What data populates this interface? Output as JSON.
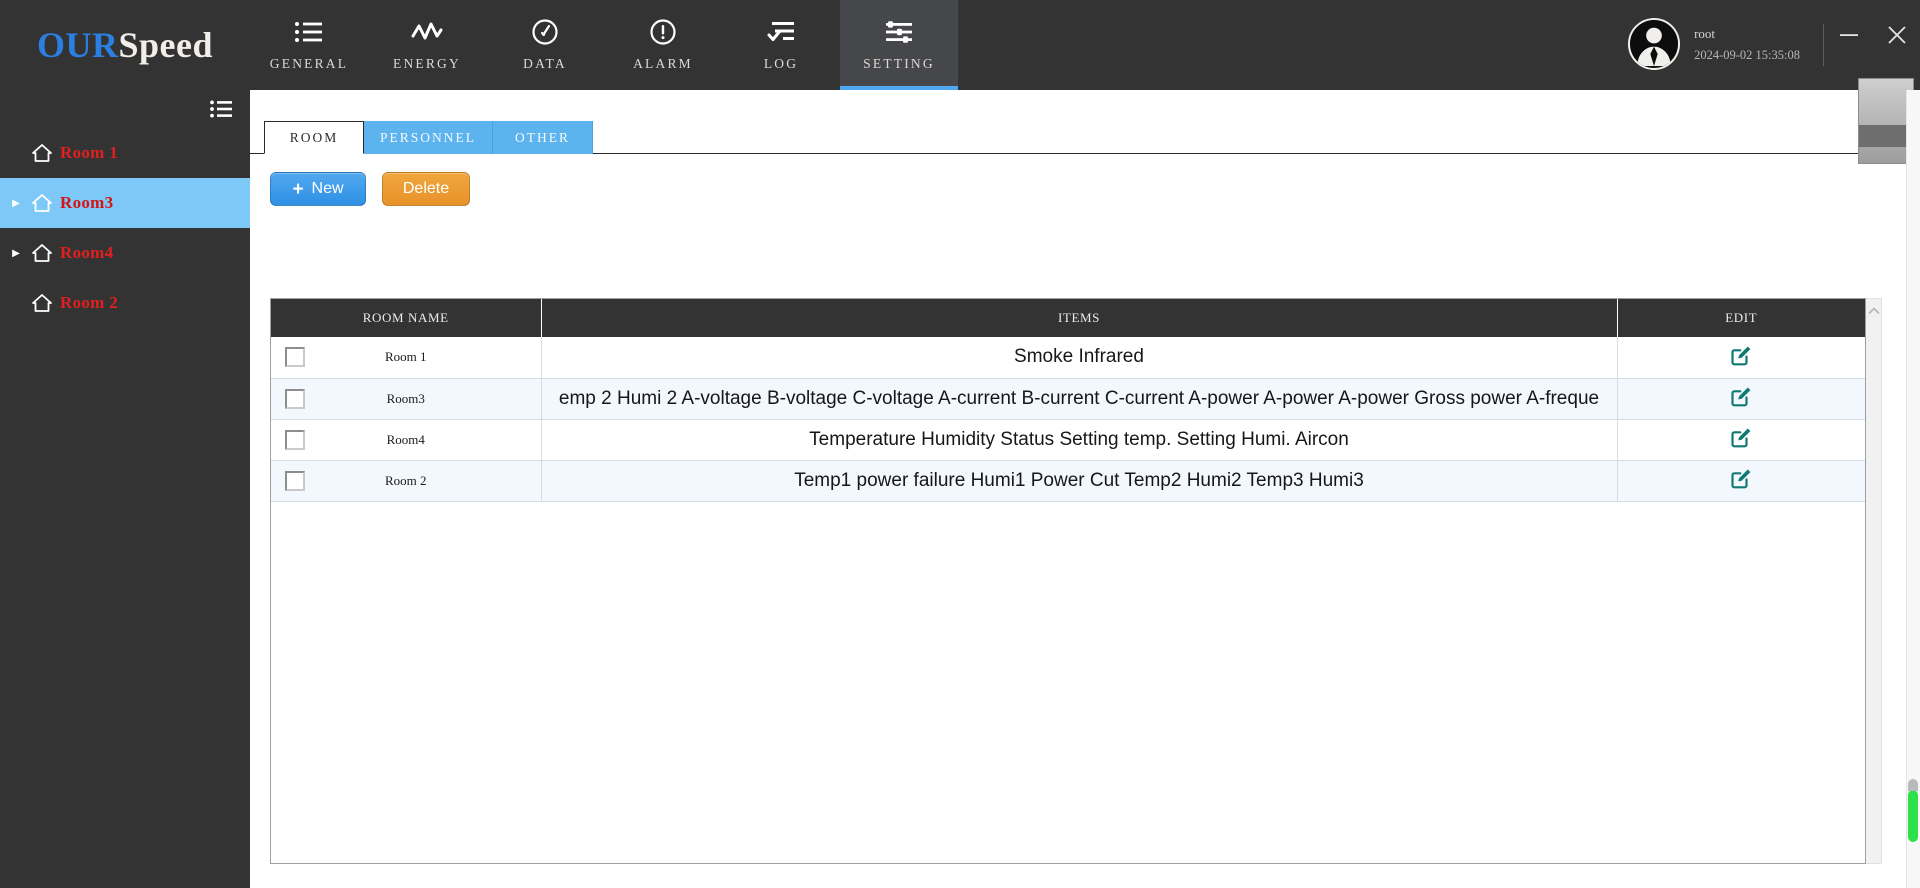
{
  "brand": {
    "part1": "OUR",
    "part2": "Speed"
  },
  "nav": {
    "items": [
      {
        "label": "GENERAL",
        "icon": "list-icon",
        "active": false
      },
      {
        "label": "ENERGY",
        "icon": "activity-wave-icon",
        "active": false
      },
      {
        "label": "DATA",
        "icon": "gauge-icon",
        "active": false
      },
      {
        "label": "ALARM",
        "icon": "exclamation-circle-icon",
        "active": false
      },
      {
        "label": "LOG",
        "icon": "log-check-icon",
        "active": false
      },
      {
        "label": "SETTING",
        "icon": "sliders-icon",
        "active": true
      }
    ]
  },
  "user": {
    "name": "root",
    "datetime": "2024-09-02 15:35:08"
  },
  "window_controls": {
    "minimize": "—",
    "close": "✕"
  },
  "sidebar": {
    "toggle_icon": "list-toggle-icon",
    "rooms": [
      {
        "label": "Room 1",
        "expandable": false,
        "selected": false
      },
      {
        "label": "Room3",
        "expandable": true,
        "selected": true
      },
      {
        "label": "Room4",
        "expandable": true,
        "selected": false
      },
      {
        "label": "Room 2",
        "expandable": false,
        "selected": false
      }
    ]
  },
  "subtabs": [
    {
      "label": "ROOM",
      "active": true
    },
    {
      "label": "PERSONNEL",
      "active": false
    },
    {
      "label": "OTHER",
      "active": false
    }
  ],
  "toolbar": {
    "new_label": "New",
    "new_plus": "+",
    "delete_label": "Delete"
  },
  "table": {
    "headers": {
      "name": "ROOM NAME",
      "items": "ITEMS",
      "edit": "EDIT"
    },
    "rows": [
      {
        "name": "Room 1",
        "items": "Smoke Infrared",
        "edit_icon": "edit-square-icon"
      },
      {
        "name": "Room3",
        "items": "emp 2 Humi 2 A-voltage B-voltage C-voltage A-current B-current C-current A-power A-power A-power Gross power A-freque",
        "edit_icon": "edit-square-icon"
      },
      {
        "name": "Room4",
        "items": "Temperature Humidity Status Setting temp. Setting Humi. Aircon",
        "edit_icon": "edit-square-icon"
      },
      {
        "name": "Room 2",
        "items": "Temp1 power failure Humi1 Power Cut  Temp2 Humi2 Temp3 Humi3",
        "edit_icon": "edit-square-icon"
      }
    ]
  },
  "scrollbars": {
    "table_up_icon": "chevron-up-icon",
    "page_thumb_color": "#2ee04a"
  },
  "colors": {
    "topbar_bg": "#333334",
    "accent_blue": "#4fa8f2",
    "room_red": "#e02020",
    "selected_row_blue": "#7dc8f7",
    "edit_teal": "#0f7a72",
    "btn_orange": "#e8922a"
  }
}
